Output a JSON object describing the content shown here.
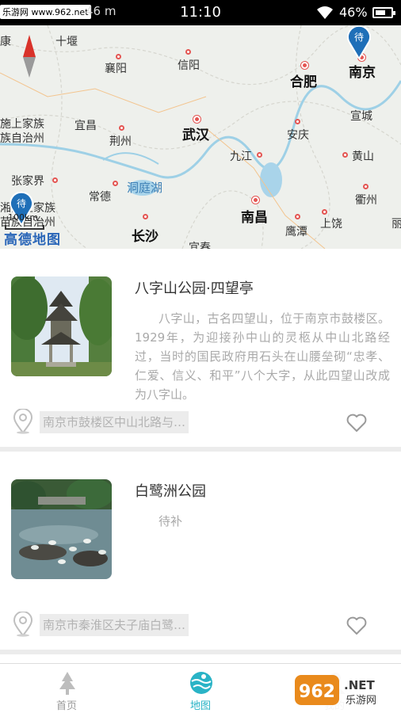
{
  "status_bar": {
    "watermark": "乐游网 www.962.net",
    "watermark_tail": "46 m",
    "time": "11:10",
    "battery": "46%"
  },
  "map": {
    "scale_label": "100km",
    "logo": "高德地图",
    "pin_label": "待",
    "cities": [
      {
        "name": "十堰",
        "type": "normal"
      },
      {
        "name": "襄阳",
        "type": "normal"
      },
      {
        "name": "信阳",
        "type": "normal"
      },
      {
        "name": "合肥",
        "type": "major"
      },
      {
        "name": "南京",
        "type": "major"
      },
      {
        "name": "宜昌",
        "type": "normal"
      },
      {
        "name": "荆州",
        "type": "normal"
      },
      {
        "name": "武汉",
        "type": "major"
      },
      {
        "name": "安庆",
        "type": "normal"
      },
      {
        "name": "宣城",
        "type": "normal"
      },
      {
        "name": "九江",
        "type": "normal"
      },
      {
        "name": "黄山",
        "type": "normal"
      },
      {
        "name": "张家界",
        "type": "normal"
      },
      {
        "name": "常德",
        "type": "normal"
      },
      {
        "name": "洞庭湖",
        "type": "blue"
      },
      {
        "name": "衢州",
        "type": "normal"
      },
      {
        "name": "南昌",
        "type": "major"
      },
      {
        "name": "长沙",
        "type": "major"
      },
      {
        "name": "鹰潭",
        "type": "normal"
      },
      {
        "name": "上饶",
        "type": "normal"
      },
      {
        "name": "宜春",
        "type": "normal"
      },
      {
        "name": "施上家族",
        "type": "normal"
      },
      {
        "name": "族自治州",
        "type": "normal"
      },
      {
        "name": "湘西土家族",
        "type": "normal"
      },
      {
        "name": "苗族自治州",
        "type": "normal"
      },
      {
        "name": "康",
        "type": "normal"
      },
      {
        "name": "丽",
        "type": "normal"
      }
    ]
  },
  "attractions": [
    {
      "title": "八字山公园·四望亭",
      "description": "八字山，古名四望山，位于南京市鼓楼区。1929年，为迎接孙中山的灵柩从中山北路经过，当时的国民政府用石头在山腰垒砌“忠孝、仁爱、信义、和平”八个大字，从此四望山改成为八字山。",
      "address": "南京市鼓楼区中山北路与…"
    },
    {
      "title": "白鹭洲公园",
      "description": "待补",
      "address": "南京市秦淮区夫子庙白鹭…"
    }
  ],
  "tabs": [
    {
      "label": "首页",
      "icon": "tree-icon",
      "active": false
    },
    {
      "label": "地图",
      "icon": "map-icon",
      "active": true
    },
    {
      "label": "我的",
      "icon": "user-icon",
      "active": false
    }
  ],
  "corner_watermark": "962.NET 乐游网",
  "colors": {
    "accent": "#2ab3c6",
    "map_marker": "#e45552",
    "pin": "#1f6fb8"
  }
}
